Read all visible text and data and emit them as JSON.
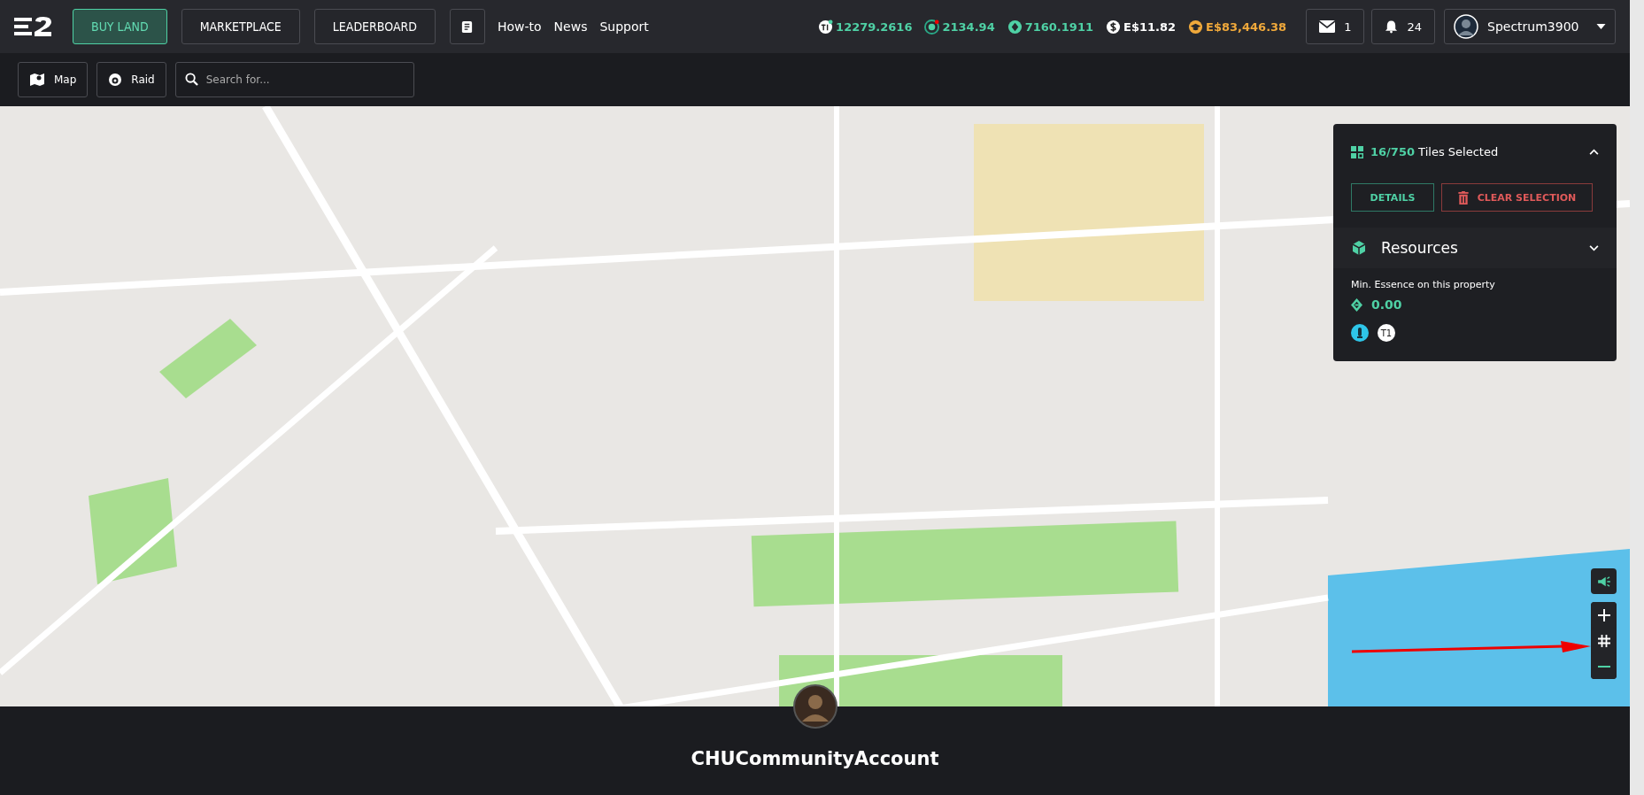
{
  "nav": {
    "buttons": [
      {
        "label": "BUY LAND",
        "selected": true
      },
      {
        "label": "MARKETPLACE",
        "selected": false
      },
      {
        "label": "LEADERBOARD",
        "selected": false
      }
    ],
    "links": [
      "How-to",
      "News",
      "Support"
    ]
  },
  "stats": [
    {
      "kind": "t1",
      "value": "12279.2616",
      "color": "#4fd1a5"
    },
    {
      "kind": "target",
      "value": "2134.94",
      "color": "#4fd1a5"
    },
    {
      "kind": "essence",
      "value": "7160.1911",
      "color": "#4fd1a5"
    },
    {
      "kind": "dollar",
      "value": "E$11.82",
      "color": "#ffffff"
    },
    {
      "kind": "cap",
      "value": "E$83,446.38",
      "color": "#f0a93b"
    }
  ],
  "mail": {
    "count": "1"
  },
  "notifications": {
    "count": "24"
  },
  "user": {
    "name": "Spectrum3900"
  },
  "toolbar": {
    "buttons": [
      {
        "kind": "map",
        "label": "Map"
      },
      {
        "kind": "raid",
        "label": "Raid"
      }
    ],
    "search": {
      "placeholder": "Search for..."
    }
  },
  "panel": {
    "count": "16/750",
    "label": "Tiles Selected",
    "details": "DETAILS",
    "clear": "CLEAR SELECTION",
    "resources": "Resources",
    "essence_label": "Min. Essence on this property",
    "essence_value": "0.00",
    "tier": "T1"
  },
  "footer": {
    "account": "CHUCommunityAccount"
  }
}
